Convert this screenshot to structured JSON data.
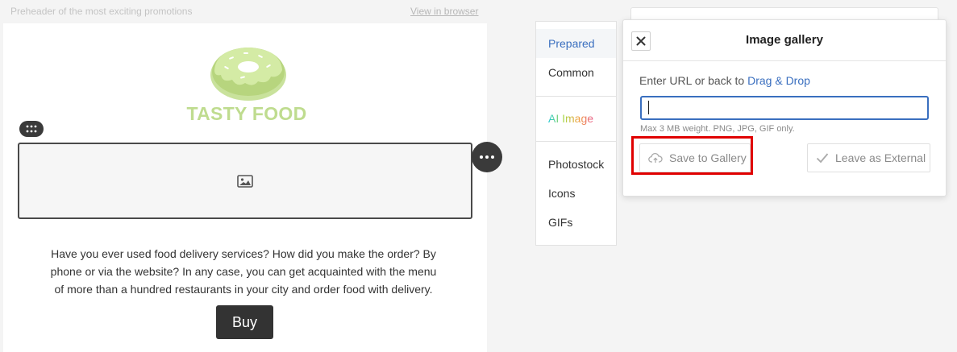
{
  "email": {
    "preheader": "Preheader of the most exciting promotions",
    "view_in_browser": "View in browser",
    "logo_text": "TASTY FOOD",
    "body_text": "Have you ever used food delivery services? How did you make the order? By phone or via the website? In any case, you can get acquainted with the menu of more than a hundred restaurants in your city and order food with delivery.",
    "buy_label": "Buy"
  },
  "tabs": [
    {
      "label": "Prepared",
      "active": true
    },
    {
      "label": "Common"
    },
    {
      "label": "AI Image"
    },
    {
      "label": "Photostock"
    },
    {
      "label": "Icons"
    },
    {
      "label": "GIFs"
    }
  ],
  "modal": {
    "title": "Image gallery",
    "url_hint_prefix": "Enter URL or back to",
    "drag_drop_link": "Drag & Drop",
    "url_value": "",
    "size_hint": "Max 3 MB weight. PNG, JPG, GIF only.",
    "save_label": "Save to Gallery",
    "leave_label": "Leave as External"
  },
  "colors": {
    "accent": "#3a6fbf",
    "logo_green": "#bfdc8f",
    "highlight": "#e00000",
    "dark_button": "#333333"
  },
  "icons": [
    "close-icon",
    "image-placeholder-icon",
    "drag-handle-icon",
    "more-dots-icon",
    "cloud-upload-icon",
    "check-icon",
    "donut-logo"
  ]
}
